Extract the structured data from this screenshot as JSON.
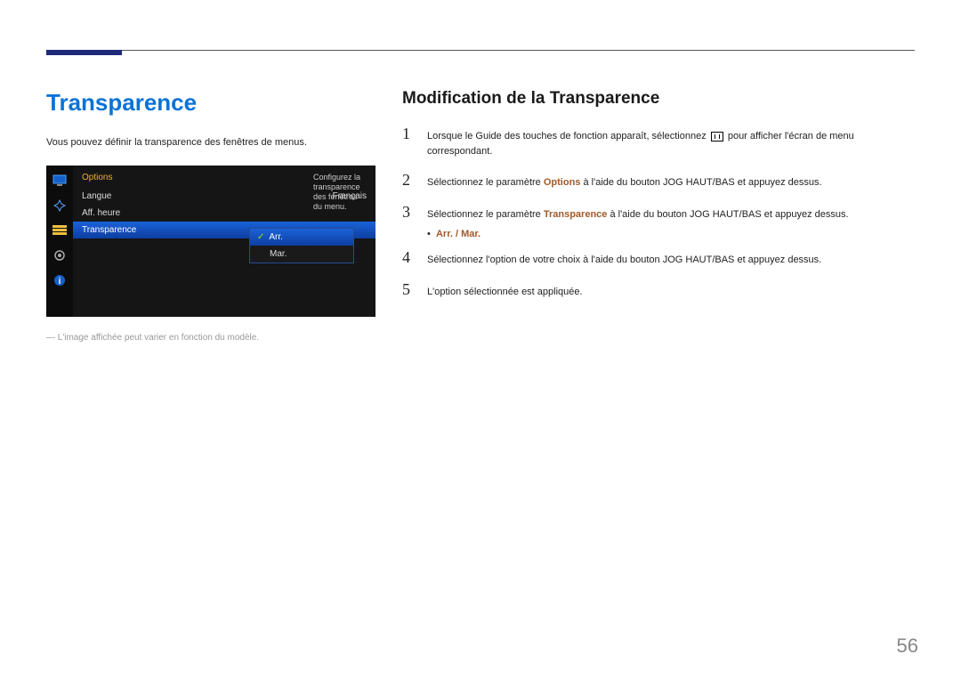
{
  "title": "Transparence",
  "intro": "Vous pouvez définir la transparence des fenêtres de menus.",
  "osd": {
    "category": "Options",
    "rows": [
      {
        "label": "Langue",
        "value": "Français"
      },
      {
        "label": "Aff. heure",
        "value": ""
      },
      {
        "label": "Transparence",
        "value": "",
        "selected": true
      }
    ],
    "submenu": [
      {
        "label": "Arr.",
        "checked": true,
        "selected": true
      },
      {
        "label": "Mar.",
        "checked": false,
        "selected": false
      }
    ],
    "help": "Configurez la transparence des fenêtres du menu."
  },
  "note": "― L'image affichée peut varier en fonction du modèle.",
  "subtitle": "Modification de la Transparence",
  "steps": {
    "s1a": "Lorsque le Guide des touches de fonction apparaît, sélectionnez ",
    "s1b": " pour afficher l'écran de menu correspondant.",
    "s2a": "Sélectionnez le paramètre ",
    "s2opt": "Options",
    "s2b": " à l'aide du bouton JOG HAUT/BAS et appuyez dessus.",
    "s3a": "Sélectionnez le paramètre ",
    "s3opt": "Transparence",
    "s3b": " à l'aide du bouton JOG HAUT/BAS et appuyez dessus.",
    "bullet": "Arr. / Mar.",
    "s4": "Sélectionnez l'option de votre choix à l'aide du bouton JOG HAUT/BAS et appuyez dessus.",
    "s5": "L'option sélectionnée est appliquée."
  },
  "page_number": "56"
}
